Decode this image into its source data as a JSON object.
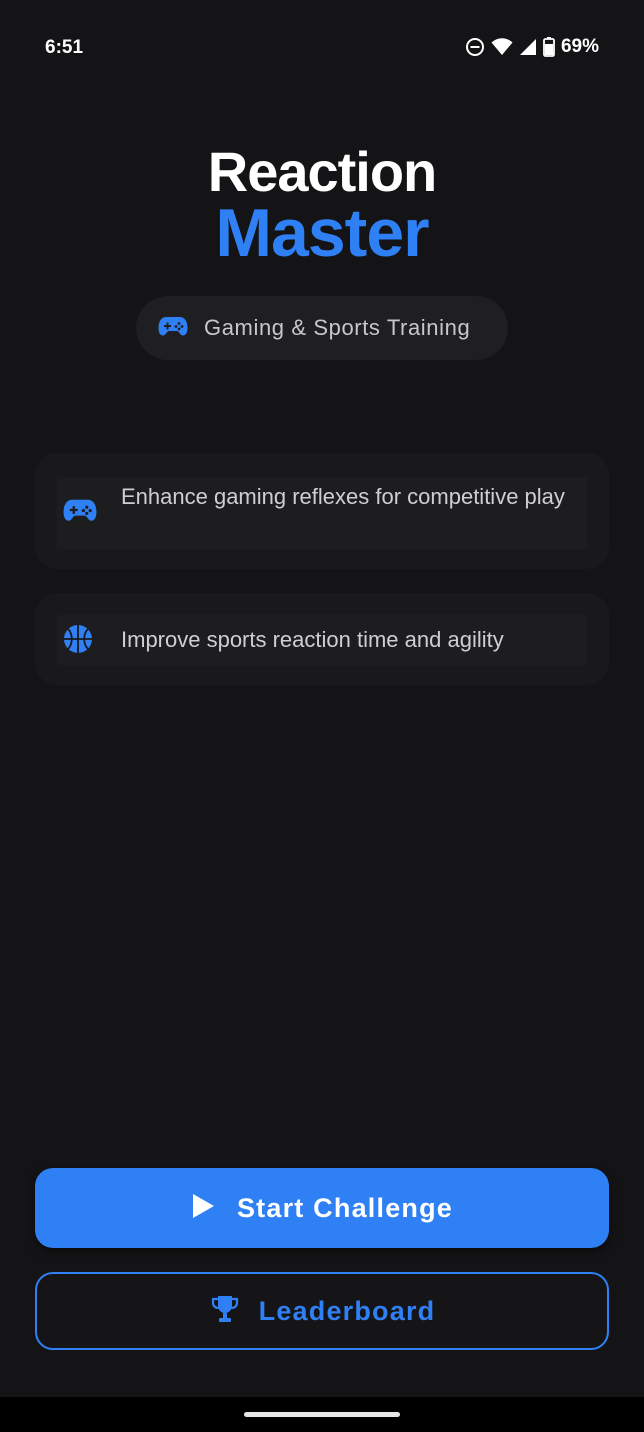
{
  "status_bar": {
    "time": "6:51",
    "battery": "69%",
    "icons": [
      "do-not-disturb-icon",
      "wifi-icon",
      "signal-icon",
      "battery-icon"
    ]
  },
  "header": {
    "title_line1": "Reaction",
    "title_line2": "Master"
  },
  "tag": {
    "icon": "gamepad-icon",
    "label": "Gaming & Sports Training"
  },
  "features": [
    {
      "icon": "gamepad-icon",
      "text": "Enhance gaming reflexes for competitive play"
    },
    {
      "icon": "basketball-icon",
      "text": "Improve sports reaction time and agility"
    }
  ],
  "actions": {
    "start_label": "Start Challenge",
    "start_icon": "play-icon",
    "leaderboard_label": "Leaderboard",
    "leaderboard_icon": "trophy-icon"
  },
  "colors": {
    "background": "#141416",
    "accent": "#2f80f5",
    "title": "#ffffff",
    "card": "#19191b"
  }
}
